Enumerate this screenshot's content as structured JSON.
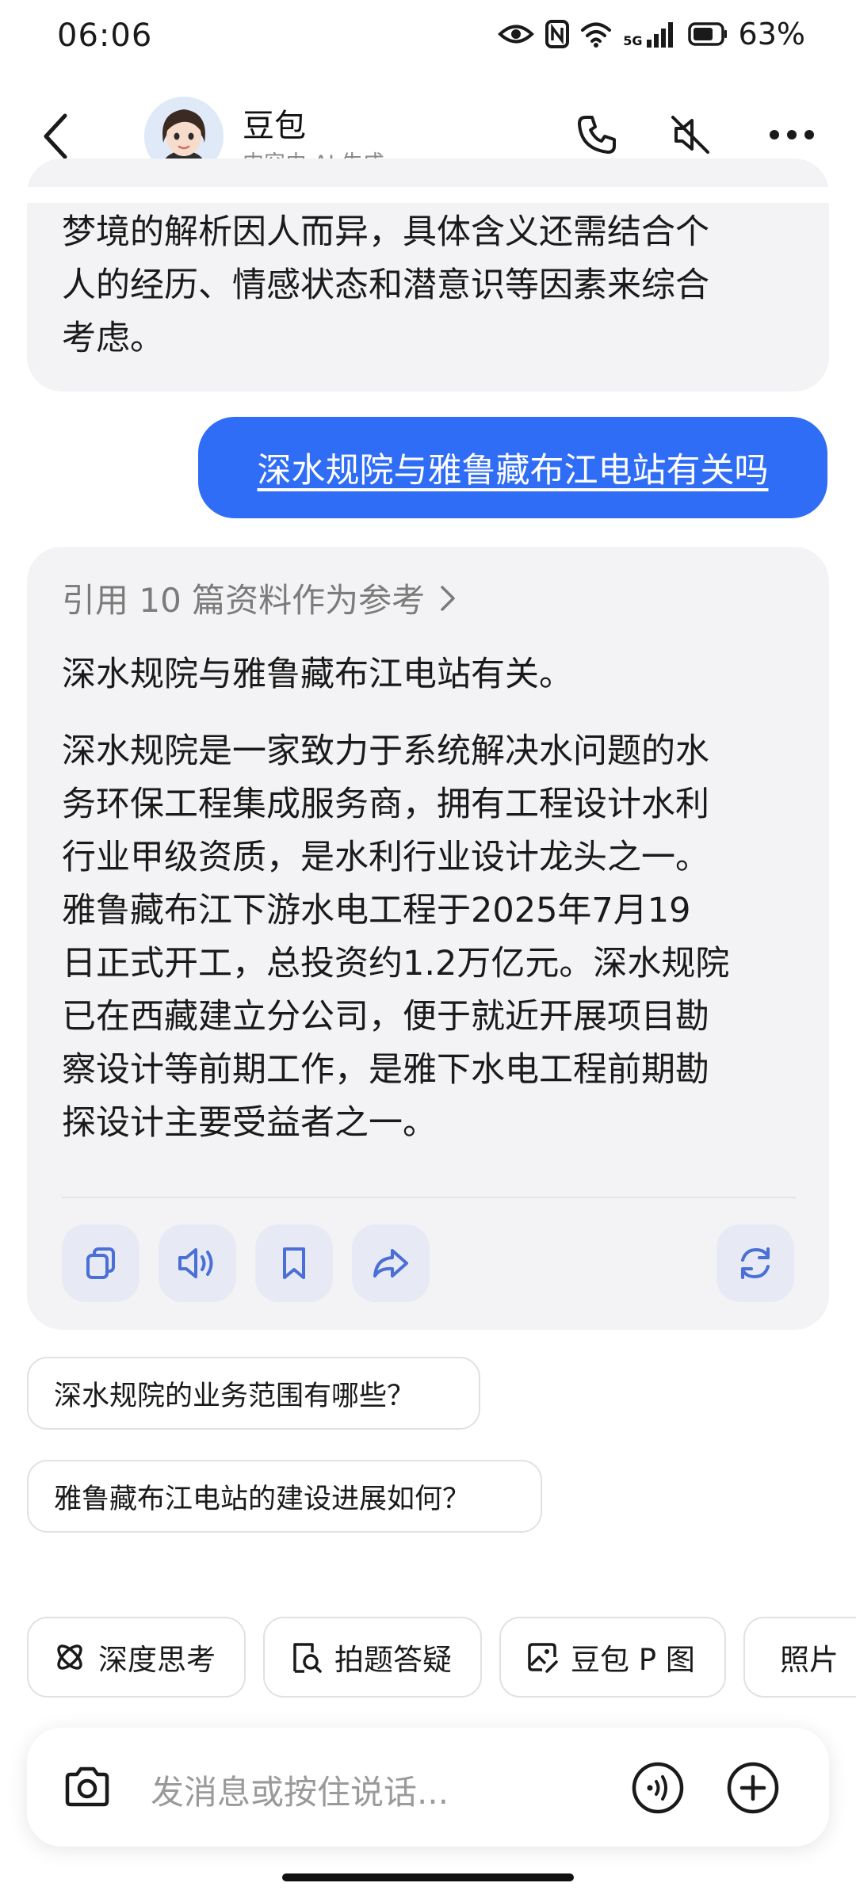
{
  "status_bar": {
    "time": "06:06",
    "network": "5G",
    "battery": "63%"
  },
  "header": {
    "title": "豆包",
    "subtitle": "内容由 AI 生成"
  },
  "prev_answer": {
    "lines": [
      "梦境的解析因人而异，具体含义还需结合个",
      "人的经历、情感状态和潜意识等因素来综合",
      "考虑。"
    ]
  },
  "user_message": "深水规院与雅鲁藏布江电站有关吗",
  "answer": {
    "reference_label": "引用 10 篇资料作为参考",
    "lines": [
      "深水规院与雅鲁藏布江电站有关。",
      "",
      "深水规院是一家致力于系统解决水问题的水",
      "务环保工程集成服务商，拥有工程设计水利",
      "行业甲级资质，是水利行业设计龙头之一。",
      "雅鲁藏布江下游水电工程于2025年7月19",
      "日正式开工，总投资约1.2万亿元。深水规院",
      "已在西藏建立分公司，便于就近开展项目勘",
      "察设计等前期工作，是雅下水电工程前期勘",
      "探设计主要受益者之一。"
    ]
  },
  "suggestions": [
    "深水规院的业务范围有哪些？",
    "雅鲁藏布江电站的建设进展如何？"
  ],
  "tools": [
    "深度思考",
    "拍题答疑",
    "豆包 P 图",
    "照片"
  ],
  "input": {
    "placeholder": "发消息或按住说话..."
  },
  "colors": {
    "accent": "#2f6df6",
    "bubble": "#f3f3f5",
    "action_bg": "#e7eaf5",
    "icon_blue": "#4a6fd6"
  }
}
